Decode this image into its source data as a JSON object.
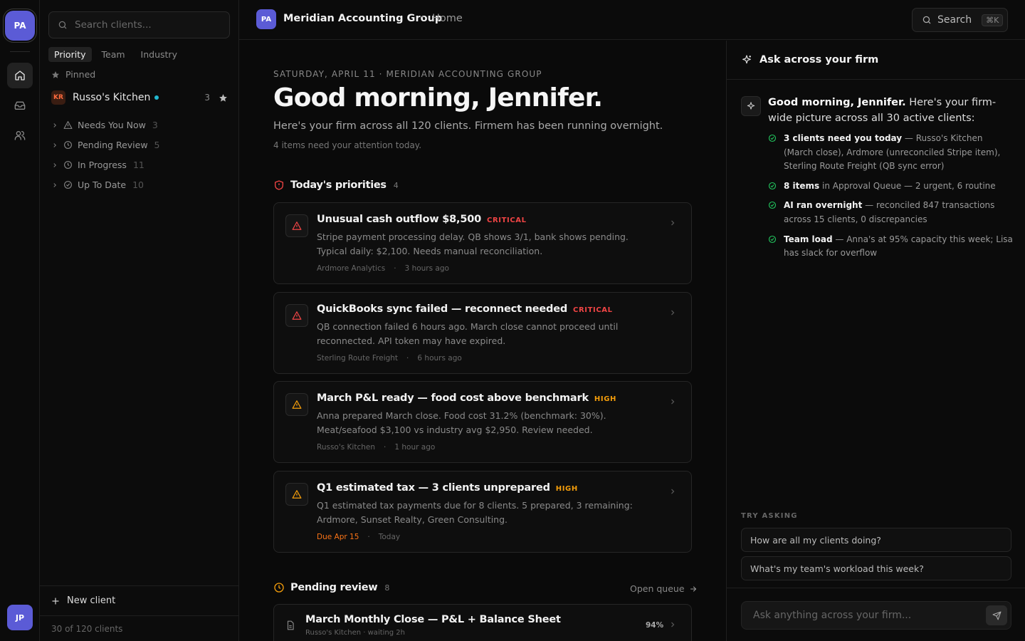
{
  "rail": {
    "org_initials": "PA",
    "user_initials": "JP"
  },
  "sidebar": {
    "search_placeholder": "Search clients...",
    "tabs": [
      "Priority",
      "Team",
      "Industry"
    ],
    "pinned_label": "Pinned",
    "pinned_client": {
      "initials": "KR",
      "name": "Russo's Kitchen",
      "count": "3"
    },
    "groups": [
      {
        "label": "Needs You Now",
        "count": "3"
      },
      {
        "label": "Pending Review",
        "count": "5"
      },
      {
        "label": "In Progress",
        "count": "11"
      },
      {
        "label": "Up To Date",
        "count": "10"
      }
    ],
    "new_client": "New client",
    "footer": "30 of 120 clients"
  },
  "topbar": {
    "logo": "PA",
    "firm": "Meridian Accounting Group",
    "separator": "·",
    "crumb": "Home",
    "search": "Search",
    "shortcut": "⌘K"
  },
  "main": {
    "date": "SATURDAY, APRIL 11 · MERIDIAN ACCOUNTING GROUP",
    "greeting": "Good morning, Jennifer.",
    "subtitle": "Here's your firm across all 120 clients. Firmem has been running overnight.",
    "subtitle2": "4 items need your attention today.",
    "priorities": {
      "title": "Today's priorities",
      "count": "4",
      "items": [
        {
          "title": "Unusual cash outflow $8,500",
          "badge": "CRITICAL",
          "desc": "Stripe payment processing delay. QB shows 3/1, bank shows pending. Typical daily: $2,100. Needs manual reconciliation.",
          "client": "Ardmore Analytics",
          "sep": "·",
          "time": "3 hours ago"
        },
        {
          "title": "QuickBooks sync failed — reconnect needed",
          "badge": "CRITICAL",
          "desc": "QB connection failed 6 hours ago. March close cannot proceed until reconnected. API token may have expired.",
          "client": "Sterling Route Freight",
          "sep": "·",
          "time": "6 hours ago"
        },
        {
          "title": "March P&L ready — food cost above benchmark",
          "badge": "HIGH",
          "desc": "Anna prepared March close. Food cost 31.2% (benchmark: 30%). Meat/seafood $3,100 vs industry avg $2,950. Review needed.",
          "client": "Russo's Kitchen",
          "sep": "·",
          "time": "1 hour ago"
        },
        {
          "title": "Q1 estimated tax — 3 clients unprepared",
          "badge": "HIGH",
          "desc": "Q1 estimated tax payments due for 8 clients. 5 prepared, 3 remaining: Ardmore, Sunset Realty, Green Consulting.",
          "client": "Due Apr 15",
          "sep": "·",
          "time": "Today"
        }
      ]
    },
    "pending": {
      "title": "Pending review",
      "count": "8",
      "open_queue": "Open queue",
      "item": {
        "title": "March Monthly Close — P&L + Balance Sheet",
        "sub": "Russo's Kitchen · waiting 2h",
        "progress": "94%"
      }
    }
  },
  "assistant": {
    "header": "Ask across your firm",
    "greeting_bold": "Good morning, Jennifer.",
    "greeting_rest": " Here's your firm-wide picture across all 30 active clients:",
    "bullets": [
      {
        "bold": "3 clients need you today",
        "rest": " — Russo's Kitchen (March close), Ardmore (unreconciled Stripe item), Sterling Route Freight (QB sync error)"
      },
      {
        "bold": "8 items",
        "rest": " in Approval Queue — 2 urgent, 6 routine"
      },
      {
        "bold": "AI ran overnight",
        "rest": " — reconciled 847 transactions across 15 clients, 0 discrepancies"
      },
      {
        "bold": "Team load",
        "rest": " — Anna's at 95% capacity this week; Lisa has slack for overflow"
      }
    ],
    "try_label": "TRY ASKING",
    "suggestions": [
      "How are all my clients doing?",
      "What's my team's workload this week?"
    ],
    "input_placeholder": "Ask anything across your firm..."
  },
  "colors": {
    "accent": "#5b5bd6",
    "critical": "#ef4444",
    "high": "#f59e0b",
    "success": "#22c55e",
    "online": "#22b8cf"
  },
  "icons": [
    "home-icon",
    "inbox-icon",
    "users-icon",
    "search-icon",
    "star-icon",
    "alert-triangle-icon",
    "clock-icon",
    "check-circle-icon",
    "chevron-right-icon",
    "sparkle-icon",
    "shield-icon",
    "file-icon",
    "send-icon",
    "plus-icon",
    "arrow-right-icon"
  ]
}
